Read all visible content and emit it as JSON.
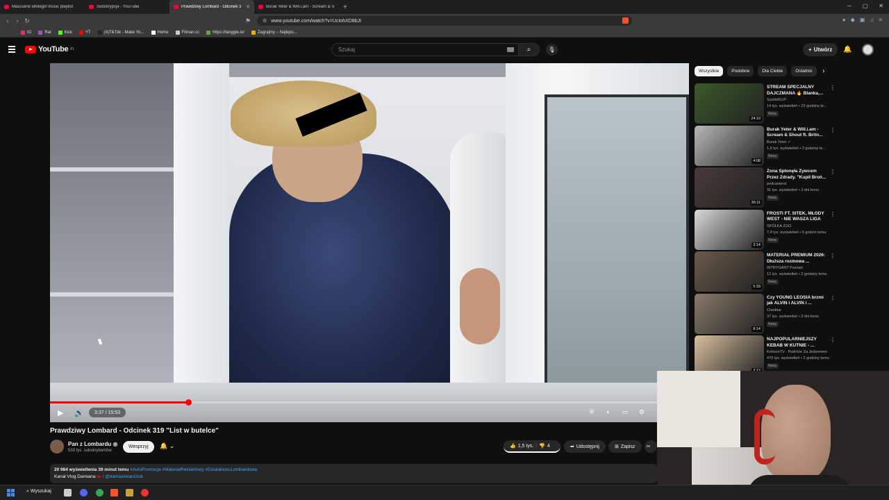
{
  "tabs": [
    {
      "label": "Masculine whitegirl music playlist",
      "active": false
    },
    {
      "label": "Subskrypcje - YouTube",
      "active": false
    },
    {
      "label": "Prawdziwy Lombard - Odcinek 3",
      "active": true
    },
    {
      "label": "Burak Yeter & Will.i.am - Scream & S",
      "active": false
    }
  ],
  "browser": {
    "url": "www.youtube.com/watch?v=UcIohXD8bJI"
  },
  "bookmarks": [
    {
      "label": "IG",
      "color": "#e1306c"
    },
    {
      "label": "Rat",
      "color": "#9b59b6"
    },
    {
      "label": "Kick",
      "color": "#53fc18"
    },
    {
      "label": "YT",
      "color": "#ff0000"
    },
    {
      "label": "(4)TikTok - Make Yo...",
      "color": "#222222"
    },
    {
      "label": "Home",
      "color": "#ffffff"
    },
    {
      "label": "Filman.cc",
      "color": "#cccccc"
    },
    {
      "label": "https://tanggle.io/",
      "color": "#5fa845"
    },
    {
      "label": "Zagrajmy – Najleps...",
      "color": "#f0b000"
    }
  ],
  "youtube": {
    "logo": "YouTube",
    "country": "PL",
    "search_placeholder": "Szukaj",
    "create_label": "Utwórz"
  },
  "player": {
    "time": "3:37 / 15:53",
    "progress_fraction": 0.228
  },
  "video": {
    "title": "Prawdziwy Lombard - Odcinek 319 \"List w butelce\"",
    "channel": "Pan z Lombardu",
    "subscribers": "533 tys. subskrybentów",
    "support_label": "Wesprzyj",
    "likes": "1,5 tys.",
    "dislikes": "4",
    "share_label": "Udostępnij",
    "save_label": "Zapisz",
    "views": "20 984 wyświetlenia",
    "age": "39 minut temu",
    "hashtags": "#AutoPromocja #MaterialReklamowy #DzialalnoscLombardowa",
    "desc_line2": "Kanał Vlog Damiana:",
    "desc_link": "/ @damianiwanczuk"
  },
  "chips": [
    "Wszystkie",
    "Podobne",
    "Dla Ciebie",
    "Ostatnio"
  ],
  "recommendations": [
    {
      "title": "STREAM SPECJALNY DAJCZMANA 🔥 Blanka,...",
      "channel": "SzybkiKLIP",
      "meta": "14 tys. wyświetleń • 23 godziny te...",
      "duration": "24:10",
      "badge": "Nowy",
      "thumb": "#3b5a2a"
    },
    {
      "title": "Burak Yeter & Will.i.am - Scream & Shout ft. Britn...",
      "channel": "Burak Yeter ✓",
      "meta": "1,6 tys. wyświetleń • 2 godziny te...",
      "duration": "4:08",
      "badge": "Nowy",
      "thumb": "#b8b8b8"
    },
    {
      "title": "Żona Spłonęła Żywcem Przez Zdrady. \"Kupił Broń...",
      "channel": "podcasterst",
      "meta": "31 tys. wyświetleń • 3 dni temu",
      "duration": "36:11",
      "badge": "Nowy",
      "thumb": "#4a3a3a"
    },
    {
      "title": "FROSTI FT. SITEK, MŁODY WEST - NIE WASZA LIGA",
      "channel": "SPÓŁKA ZOO",
      "meta": "7,4 tys. wyświetleń • 5 godzin temu",
      "duration": "3:14",
      "badge": "Nowy",
      "thumb": "#d9d9d9"
    },
    {
      "title": "MATERIAŁ PREMIUM 2026: Dłuższa rozmowa ...",
      "channel": "INTRYGANT Poznań",
      "meta": "12 tys. wyświetleń • 2 godziny temu",
      "duration": "5:33",
      "badge": "Nowy",
      "thumb": "#6b5a4a"
    },
    {
      "title": "Czy YOUNG LEOSIA brzmi jak ALVIN i ALVIN i ...",
      "channel": "Cheddar",
      "meta": "37 tys. wyświetleń • 3 dni temu",
      "duration": "8:14",
      "badge": "Nowy",
      "thumb": "#8a7a6a"
    },
    {
      "title": "NAJPOPULARNIEJSZY KEBAB W KUTNIE - ...",
      "channel": "KebsonTV - Podróże Za Jedzeniem",
      "meta": "470 tys. wyświetleń • 2 godziny temu",
      "duration": "2:12",
      "badge": "Nowy",
      "thumb": "#d8c0a0"
    }
  ],
  "taskbar": {
    "search_label": "Wyszukaj"
  }
}
